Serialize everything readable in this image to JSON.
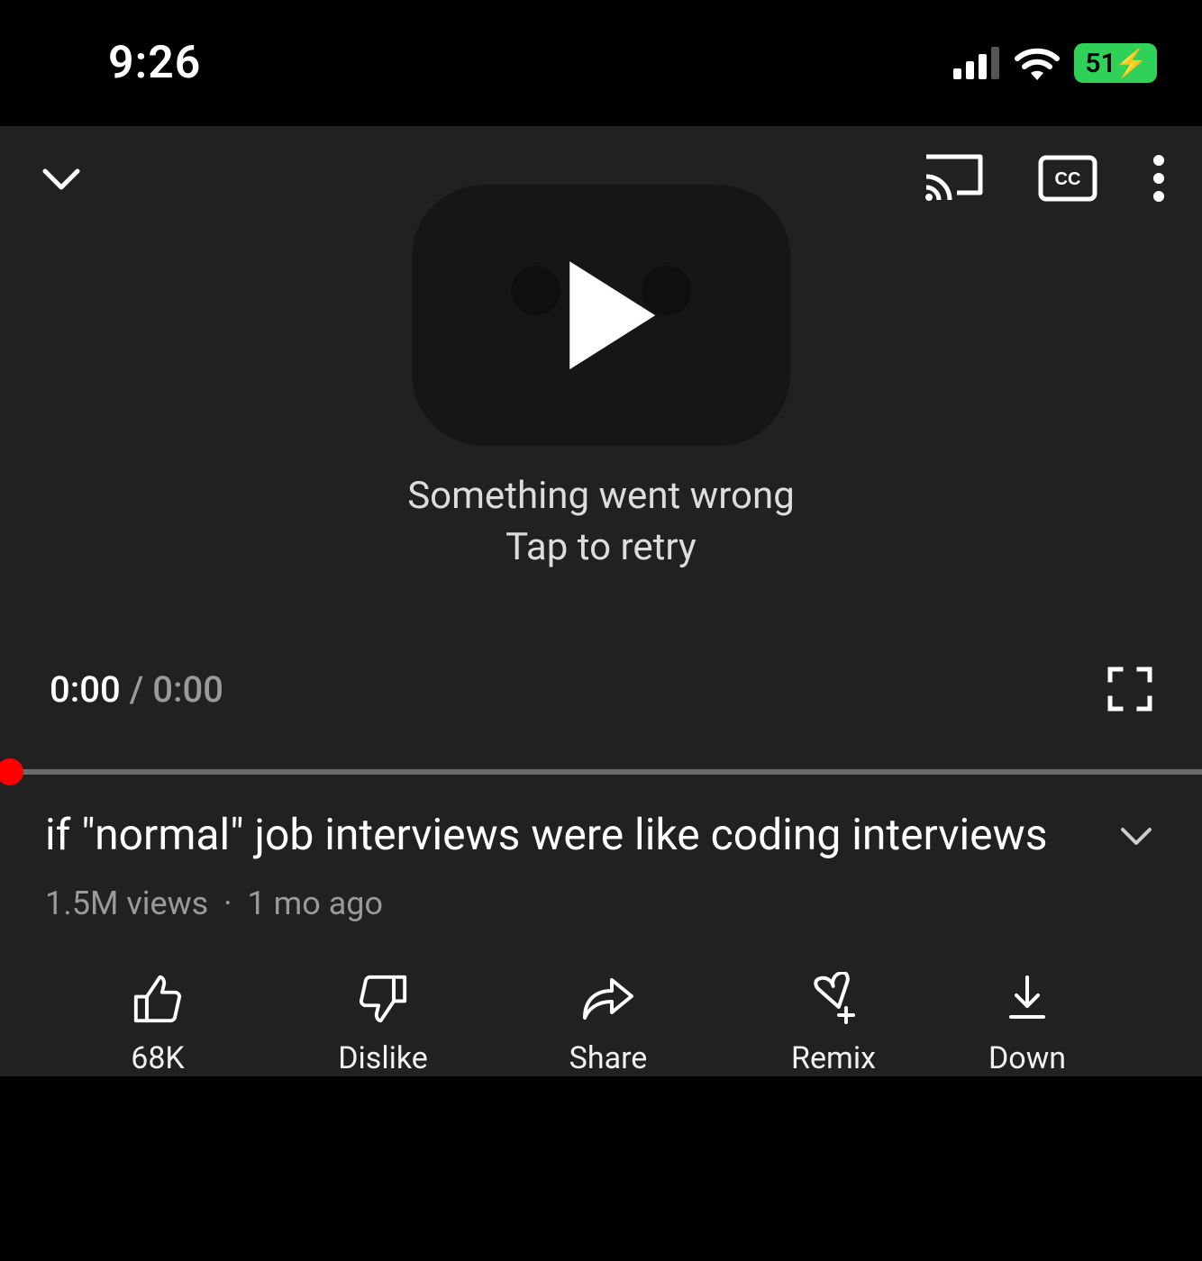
{
  "status": {
    "time": "9:26",
    "battery_percent": "51"
  },
  "player": {
    "error_line1": "Something went wrong",
    "error_line2": "Tap to retry",
    "current_time": "0:00",
    "duration": "0:00"
  },
  "video": {
    "title": "if \"normal\" job interviews were like coding interviews",
    "views": "1.5M views",
    "age": "1 mo ago"
  },
  "actions": {
    "like": "68K",
    "dislike": "Dislike",
    "share": "Share",
    "remix": "Remix",
    "download": "Down"
  }
}
